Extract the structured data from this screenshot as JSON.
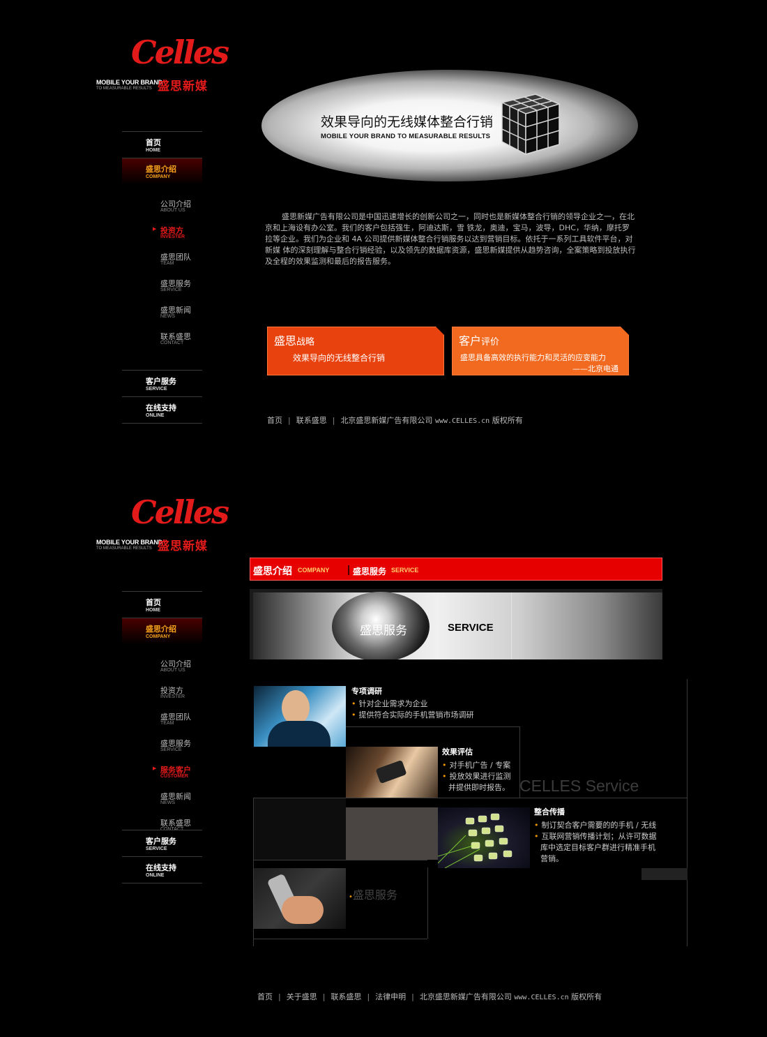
{
  "logo": {
    "script": "Celles",
    "tagline": "MOBILE YOUR BRAND",
    "subtagline": "TO MEASURABLE RESULTS",
    "cn": "盛思新媒"
  },
  "nav": {
    "home": {
      "cn": "首页",
      "en": "HOME"
    },
    "company": {
      "cn": "盛思介绍",
      "en": "COMPANY"
    },
    "service": {
      "cn": "客户服务",
      "en": "SERVICE"
    },
    "online": {
      "cn": "在线支持",
      "en": "ONLINE"
    }
  },
  "page1": {
    "submenu": [
      {
        "cn": "公司介绍",
        "en": "ABOUT US"
      },
      {
        "cn": "投资方",
        "en": "INVESTER"
      },
      {
        "cn": "盛思团队",
        "en": "TEAM"
      },
      {
        "cn": "盛思服务",
        "en": "SERVICE"
      },
      {
        "cn": "盛思新闻",
        "en": "NEWS"
      },
      {
        "cn": "联系盛思",
        "en": "CONTACT"
      }
    ],
    "hero": {
      "title": "效果导向的无线媒体整合行销",
      "subtitle": "MOBILE YOUR BRAND TO MEASURABLE RESULTS"
    },
    "intro": "盛思新媒广告有限公司是中国迅速增长的创新公司之一，同时也是新媒体整合行销的领导企业之一，在北京和上海设有办公室。我们的客户包括强生，阿迪达斯，雪 铁龙，奥迪，宝马，波导，DHC，华纳，摩托罗拉等企业。我们为企业和 4A 公司提供新媒体整合行销服务以达到营销目标。依托于一系列工具软件平台，对新媒 体的深刻理解与整合行销经验，以及领先的数据库资源，盛思新媒提供从趋势咨询，全案策略到投放执行及全程的效果监测和最后的报告服务。",
    "strategy": {
      "head_big": "盛思",
      "head_small": "战略",
      "text": "效果导向的无线整合行销"
    },
    "review": {
      "head_big": "客户",
      "head_small": "评价",
      "text": "盛思具备高效的执行能力和灵活的应变能力",
      "author": "——北京电通"
    },
    "footer": {
      "home": "首页",
      "contact": "联系盛思",
      "company": "北京盛思新媒广告有限公司",
      "site": "www.CELLES.cn",
      "rights": "版权所有"
    }
  },
  "page2": {
    "submenu": [
      {
        "cn": "公司介绍",
        "en": "ABOUT US"
      },
      {
        "cn": "投资方",
        "en": "INVESTER"
      },
      {
        "cn": "盛思团队",
        "en": "TEAM"
      },
      {
        "cn": "盛思服务",
        "en": "SERVICE"
      },
      {
        "cn": "服务客户",
        "en": "CUSTOMER"
      },
      {
        "cn": "盛思新闻",
        "en": "NEWS"
      },
      {
        "cn": "联系盛思",
        "en": "CONTACT"
      }
    ],
    "bar": {
      "cn1": "盛思介绍",
      "en1": "COMPANY",
      "cn2": "盛思服务",
      "en2": "SERVICE"
    },
    "hero": {
      "cn": "盛思服务",
      "en": "SERVICE"
    },
    "services": [
      {
        "title": "专项调研",
        "items": [
          "针对企业需求为企业",
          "提供符合实际的手机营销市场调研"
        ]
      },
      {
        "title": "效果评估",
        "items": [
          "对手机广告 / 专案",
          "投放效果进行监测"
        ],
        "cont": "并提供即时报告。"
      },
      {
        "title": "整合传播",
        "items": [
          "制订契合客户需要的的手机 / 无线",
          "互联网营销传播计划；从许可数据"
        ],
        "cont": [
          "库中选定目标客户群进行精准手机",
          "营销。"
        ]
      }
    ],
    "watermark": "CELLES Service",
    "bottom_label": "盛思服务",
    "footer": {
      "home": "首页",
      "about": "关于盛思",
      "contact": "联系盛思",
      "legal": "法律申明",
      "company": "北京盛思新媒广告有限公司",
      "site": "www.CELLES.cn",
      "rights": "版权所有"
    }
  },
  "colors": {
    "accent_red": "#e60000",
    "orange_dark": "#e8430e",
    "orange_light": "#f26a1f",
    "nav_active": "#f4a21c"
  }
}
